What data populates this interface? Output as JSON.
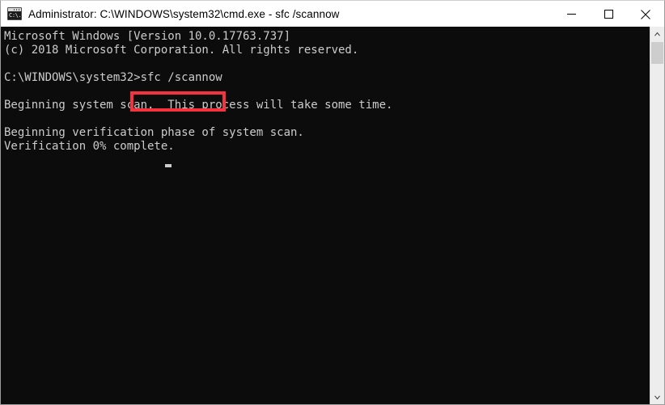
{
  "window": {
    "title": "Administrator: C:\\WINDOWS\\system32\\cmd.exe - sfc  /scannow",
    "icon": "console-icon",
    "icon_text": "C:\\.",
    "controls": {
      "minimize_label": "Minimize",
      "maximize_label": "Maximize",
      "close_label": "Close"
    },
    "colors": {
      "titlebar_background": "#ffffff",
      "titlebar_text": "#000000",
      "console_background": "#0c0c0c",
      "console_text": "#cccccc",
      "window_border": "#9b9b9b",
      "highlight_red": "#f5333f",
      "scrollbar_track": "#ededed",
      "scrollbar_thumb": "#cdcdcd"
    }
  },
  "console": {
    "prompt": "C:\\WINDOWS\\system32>",
    "command": "sfc /scannow",
    "cursor": "_",
    "output": "Microsoft Windows [Version 10.0.17763.737]\n(c) 2018 Microsoft Corporation. All rights reserved.\n\nC:\\WINDOWS\\system32>sfc /scannow\n\nBeginning system scan.  This process will take some time.\n\nBeginning verification phase of system scan.\nVerification 0% complete.",
    "lines": [
      "Microsoft Windows [Version 10.0.17763.737]",
      "(c) 2018 Microsoft Corporation. All rights reserved.",
      "",
      "C:\\WINDOWS\\system32>sfc /scannow",
      "",
      "Beginning system scan.  This process will take some time.",
      "",
      "Beginning verification phase of system scan.",
      "Verification 0% complete."
    ],
    "version": "10.0.17763.737",
    "copyright_year": "2018",
    "progress_percent": "0%"
  },
  "scrollbar": {
    "up_arrow": "scroll-up-icon",
    "down_arrow": "scroll-down-icon",
    "thumb": "scroll-thumb"
  }
}
